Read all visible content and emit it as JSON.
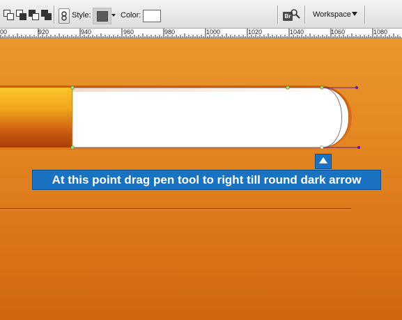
{
  "optionsbar": {
    "style_label": "Style:",
    "color_label": "Color:",
    "bridge_label": "Br",
    "workspace_label": "Workspace"
  },
  "ruler": {
    "labels": [
      "00",
      "920",
      "940",
      "960",
      "980",
      "1000",
      "1020",
      "1040",
      "1060",
      "1080"
    ]
  },
  "canvas": {
    "instruction": "At this point drag pen tool to right till round dark arrow"
  },
  "colors": {
    "background_orange": "#e58a24",
    "instruction_blue": "#1a73c2",
    "path_purple": "#6a1a9a"
  }
}
